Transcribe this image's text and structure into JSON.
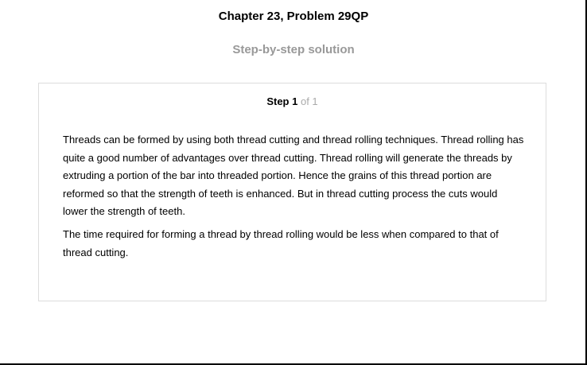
{
  "header": {
    "title": "Chapter 23, Problem 29QP",
    "subtitle": "Step-by-step solution"
  },
  "step": {
    "label": "Step 1",
    "of": "of 1"
  },
  "paragraphs": [
    "Threads can be formed by using both thread cutting and thread rolling techniques. Thread rolling has quite a good number of advantages over thread cutting. Thread rolling will generate the threads by extruding a portion of the bar into threaded portion. Hence the grains of this thread portion are reformed so that the strength of teeth is enhanced. But in thread cutting process the cuts would lower the strength of teeth.",
    "The time required for forming a thread by thread rolling would be less when compared to that of thread cutting."
  ]
}
